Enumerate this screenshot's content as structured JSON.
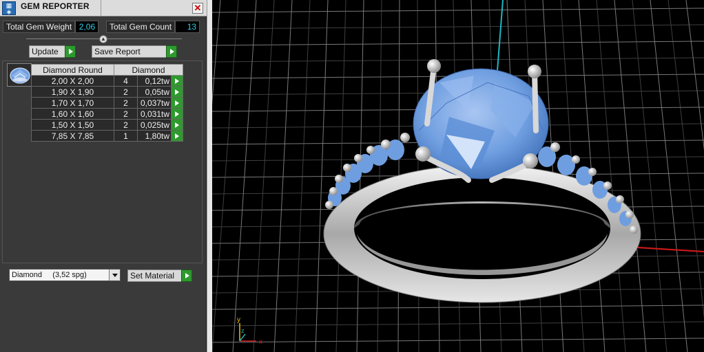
{
  "window": {
    "title": "GEM REPORTER",
    "close_glyph": "✕",
    "icon": "gem-reporter-icon"
  },
  "summary": {
    "weight_label": "Total Gem Weight",
    "weight_value": "2,06",
    "count_label": "Total Gem Count",
    "count_value": "13"
  },
  "toolbar": {
    "update_label": "Update",
    "save_report_label": "Save Report"
  },
  "table": {
    "headers": [
      "Diamond Round",
      "Diamond"
    ],
    "rows": [
      {
        "size": "2,00 X 2,00",
        "count": "4",
        "weight": "0,12tw"
      },
      {
        "size": "1,90 X 1,90",
        "count": "2",
        "weight": "0,05tw"
      },
      {
        "size": "1,70 X 1,70",
        "count": "2",
        "weight": "0,037tw"
      },
      {
        "size": "1,60 X 1,60",
        "count": "2",
        "weight": "0,031tw"
      },
      {
        "size": "1,50 X 1,50",
        "count": "2",
        "weight": "0,025tw"
      },
      {
        "size": "7,85 X 7,85",
        "count": "1",
        "weight": "1,80tw"
      }
    ]
  },
  "material": {
    "selected": "Diamond     (3,52 spg)",
    "set_label": "Set Material"
  },
  "viewport": {
    "axis_x_label": "x",
    "axis_y_label": "y",
    "axis_z_label": "z"
  },
  "colors": {
    "accent_value": "#2fd0e6",
    "go_button": "#2e9a2e",
    "gem_blue": "#6f9ee0",
    "axis_x": "#d01a1a",
    "axis_y": "#1fb7c4",
    "grid": "#9a9a9a"
  }
}
